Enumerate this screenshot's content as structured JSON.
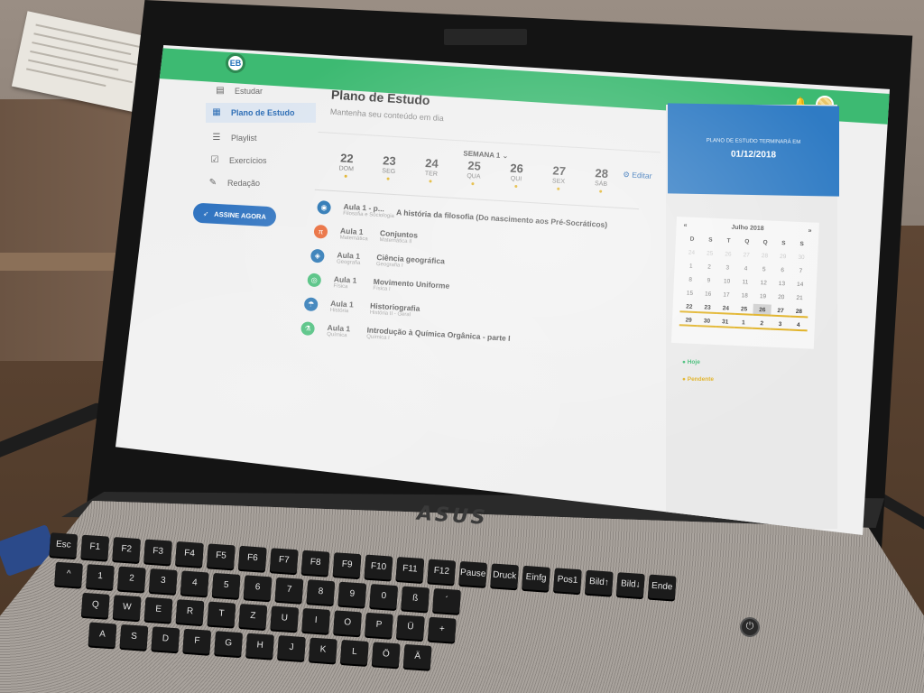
{
  "brand": {
    "logo_text": "EB",
    "laptop_brand": "ASUS"
  },
  "sidebar": {
    "items": [
      {
        "label": "Estudar",
        "icon": "book-icon"
      },
      {
        "label": "Plano de Estudo",
        "icon": "calendar-icon",
        "active": true
      },
      {
        "label": "Playlist",
        "icon": "playlist-icon"
      },
      {
        "label": "Exercícios",
        "icon": "exercise-icon"
      },
      {
        "label": "Redação",
        "icon": "pencil-icon"
      }
    ],
    "cta_label": "ASSINE AGORA"
  },
  "header": {
    "title": "Plano de Estudo",
    "subtitle": "Mantenha seu conteúdo em dia"
  },
  "week": {
    "label": "SEMANA 1",
    "edit_label": "Editar",
    "days": [
      {
        "num": "22",
        "name": "DOM"
      },
      {
        "num": "23",
        "name": "SEG"
      },
      {
        "num": "24",
        "name": "TER"
      },
      {
        "num": "25",
        "name": "QUA"
      },
      {
        "num": "26",
        "name": "QUI"
      },
      {
        "num": "27",
        "name": "SEX"
      },
      {
        "num": "28",
        "name": "SÁB"
      }
    ]
  },
  "lessons": [
    {
      "aula": "Aula 1 - p...",
      "subject": "Filosofia e Sociologia",
      "topic": "A história da filosofia (Do nascimento aos Pré-Socráticos)",
      "topic_sub": "",
      "color": "#1e6fb0"
    },
    {
      "aula": "Aula 1",
      "subject": "Matemática",
      "topic": "Conjuntos",
      "topic_sub": "Matemática II",
      "color": "#e8622d"
    },
    {
      "aula": "Aula 1",
      "subject": "Geografia",
      "topic": "Ciência geográfica",
      "topic_sub": "Geografia I",
      "color": "#1e6fb0"
    },
    {
      "aula": "Aula 1",
      "subject": "Física",
      "topic": "Movimento Uniforme",
      "topic_sub": "Física I",
      "color": "#3dba72"
    },
    {
      "aula": "Aula 1",
      "subject": "História",
      "topic": "Historiografia",
      "topic_sub": "História II - Geral",
      "color": "#1e6fb0"
    },
    {
      "aula": "Aula 1",
      "subject": "Química",
      "topic": "Introdução à Química Orgânica - parte I",
      "topic_sub": "Química I",
      "color": "#3dba72"
    }
  ],
  "plan_card": {
    "label": "PLANO DE ESTUDO TERMINARÁ EM",
    "date": "01/12/2018"
  },
  "calendar": {
    "prev": "«",
    "month": "Julho 2018",
    "next": "»",
    "weekdays": [
      "D",
      "S",
      "T",
      "Q",
      "Q",
      "S",
      "S"
    ],
    "rows": [
      [
        "24",
        "25",
        "26",
        "27",
        "28",
        "29",
        "30"
      ],
      [
        "1",
        "2",
        "3",
        "4",
        "5",
        "6",
        "7"
      ],
      [
        "8",
        "9",
        "10",
        "11",
        "12",
        "13",
        "14"
      ],
      [
        "15",
        "16",
        "17",
        "18",
        "19",
        "20",
        "21"
      ],
      [
        "22",
        "23",
        "24",
        "25",
        "26",
        "27",
        "28"
      ],
      [
        "29",
        "30",
        "31",
        "1",
        "2",
        "3",
        "4"
      ]
    ]
  },
  "legend": {
    "today": "Hoje",
    "pending": "Pendente"
  },
  "keyboard": {
    "row1": [
      "Esc",
      "F1",
      "F2",
      "F3",
      "F4",
      "F5",
      "F6",
      "F7",
      "F8",
      "F9",
      "F10",
      "F11",
      "F12",
      "Pause",
      "Druck",
      "Einfg",
      "Pos1",
      "Bild↑",
      "Bild↓",
      "Ende"
    ],
    "row2": [
      "^",
      "1",
      "2",
      "3",
      "4",
      "5",
      "6",
      "7",
      "8",
      "9",
      "0",
      "ß",
      "´"
    ],
    "row3": [
      "Q",
      "W",
      "E",
      "R",
      "T",
      "Z",
      "U",
      "I",
      "O",
      "P",
      "Ü",
      "+"
    ],
    "row4": [
      "A",
      "S",
      "D",
      "F",
      "G",
      "H",
      "J",
      "K",
      "L",
      "Ö",
      "Ä"
    ]
  },
  "colors": {
    "green": "#3dba72",
    "blue": "#2f7bc4",
    "accent_yellow": "#e0b020"
  }
}
